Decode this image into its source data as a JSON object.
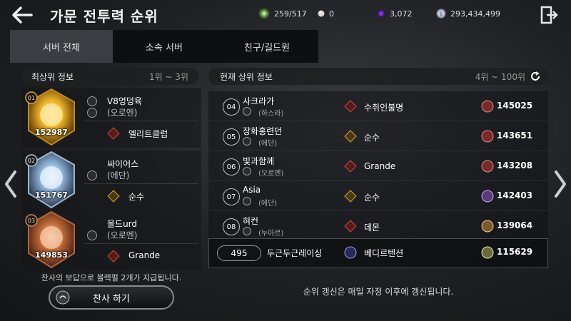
{
  "header": {
    "title": "가문 전투력 순위",
    "resources": [
      {
        "icon": "green-gem-icon",
        "value": "259/517",
        "color": "#6aa84f"
      },
      {
        "icon": "pearl-icon",
        "value": "0",
        "color": "#e0d8d4"
      },
      {
        "icon": "purple-crystal-icon",
        "value": "3,072",
        "color": "#7b2fd6"
      },
      {
        "icon": "silver-coin-icon",
        "value": "293,434,499",
        "color": "#c9d3e0"
      }
    ]
  },
  "tabs": [
    {
      "label": "서버 전체",
      "active": true
    },
    {
      "label": "소속 서버",
      "active": false
    },
    {
      "label": "친구/길드원",
      "active": false
    }
  ],
  "top_section": {
    "title": "최상위 정보",
    "range": "1위 ~ 3위",
    "entries": [
      {
        "rank": "01",
        "score": "152987",
        "name": "V8엉덩육",
        "server": "(오로엔)",
        "guild": "엘리트클럽",
        "medal": "gold"
      },
      {
        "rank": "02",
        "score": "151767",
        "name": "싸이어스",
        "server": "(에단)",
        "guild": "순수",
        "medal": "silver"
      },
      {
        "rank": "03",
        "score": "149853",
        "name": "올드urd",
        "server": "(오로엔)",
        "guild": "Grande",
        "medal": "bronze"
      }
    ],
    "reward_text": "찬사의 보답으로 블랙펄 2개가 지급됩니다.",
    "cheer_label": "찬사 하기"
  },
  "current_section": {
    "title": "현재 상위 정보",
    "range": "4위 ~ 100위",
    "rows": [
      {
        "rank": "04",
        "name": "사크라가",
        "server": "(하스라)",
        "guild": "수취인불명",
        "score": "145025"
      },
      {
        "rank": "05",
        "name": "장화홍련던",
        "server": "(에단)",
        "guild": "순수",
        "score": "143651"
      },
      {
        "rank": "06",
        "name": "빛과함께",
        "server": "(오로엔)",
        "guild": "Grande",
        "score": "143208"
      },
      {
        "rank": "07",
        "name": "Asia",
        "server": "(에단)",
        "guild": "순수",
        "score": "142403"
      },
      {
        "rank": "08",
        "name": "혀컨",
        "server": "(누아르)",
        "guild": "데몬",
        "score": "139064"
      }
    ],
    "my_row": {
      "rank": "495",
      "name": "두근두근레이싱",
      "guild": "베디르텐션",
      "score": "115629"
    },
    "update_text": "순위 갱신은 매일 자정 이후에 갱신됩니다."
  }
}
